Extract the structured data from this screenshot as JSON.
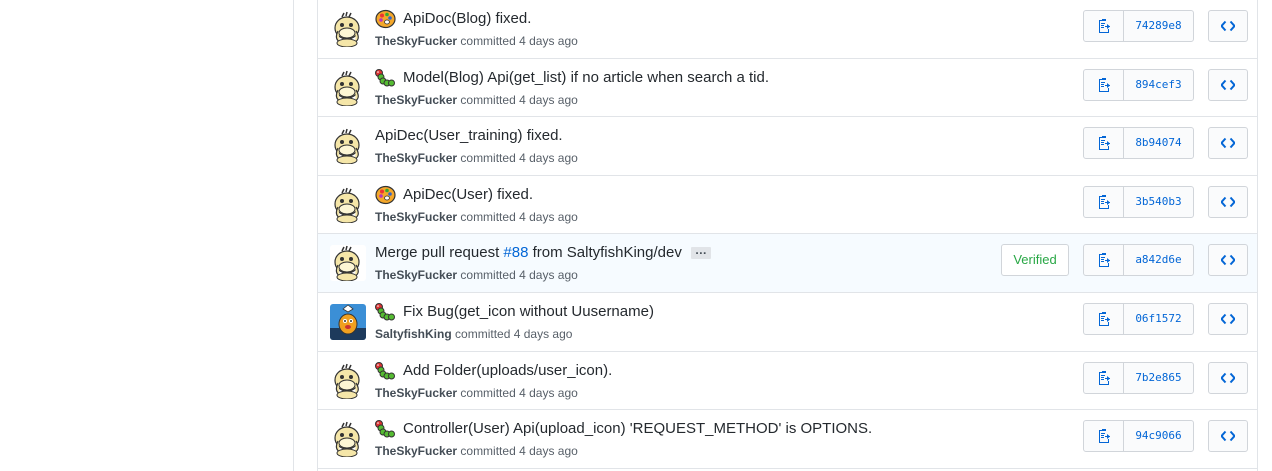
{
  "colors": {
    "link": "#0366d6",
    "verified": "#28a745",
    "border": "#e1e4e8",
    "highlight_row": "#f6fbff"
  },
  "commits": [
    {
      "emoji": "artist-palette-icon",
      "message": "ApiDoc(Blog) fixed.",
      "author": "TheSkyFucker",
      "avatar": "psyduck",
      "committed": "committed",
      "when": "4 days ago",
      "sha": "74289e8"
    },
    {
      "emoji": "caterpillar-bug-icon",
      "message": "Model(Blog) Api(get_list) if no article when search a tid.",
      "author": "TheSkyFucker",
      "avatar": "psyduck",
      "committed": "committed",
      "when": "4 days ago",
      "sha": "894cef3"
    },
    {
      "emoji": "",
      "message": "ApiDec(User_training) fixed.",
      "author": "TheSkyFucker",
      "avatar": "psyduck",
      "committed": "committed",
      "when": "4 days ago",
      "sha": "8b94074"
    },
    {
      "emoji": "artist-palette-icon",
      "message": "ApiDec(User) fixed.",
      "author": "TheSkyFucker",
      "avatar": "psyduck",
      "committed": "committed",
      "when": "4 days ago",
      "sha": "3b540b3"
    },
    {
      "emoji": "",
      "message_prefix": "Merge pull request ",
      "issue": "#88",
      "message_suffix": " from SaltyfishKing/dev",
      "ellipsis": "…",
      "author": "TheSkyFucker",
      "avatar": "psyduck",
      "committed": "committed",
      "when": "4 days ago",
      "verified": "Verified",
      "sha": "a842d6e"
    },
    {
      "emoji": "caterpillar-bug-icon",
      "message": "Fix Bug(get_icon without Uusername)",
      "author": "SaltyfishKing",
      "avatar": "saltyfish",
      "committed": "committed",
      "when": "4 days ago",
      "sha": "06f1572"
    },
    {
      "emoji": "caterpillar-bug-icon",
      "message": "Add Folder(uploads/user_icon).",
      "author": "TheSkyFucker",
      "avatar": "psyduck",
      "committed": "committed",
      "when": "4 days ago",
      "sha": "7b2e865"
    },
    {
      "emoji": "caterpillar-bug-icon",
      "message": "Controller(User) Api(upload_icon) 'REQUEST_METHOD' is OPTIONS.",
      "author": "TheSkyFucker",
      "avatar": "psyduck",
      "committed": "committed",
      "when": "4 days ago",
      "sha": "94c9066"
    }
  ]
}
